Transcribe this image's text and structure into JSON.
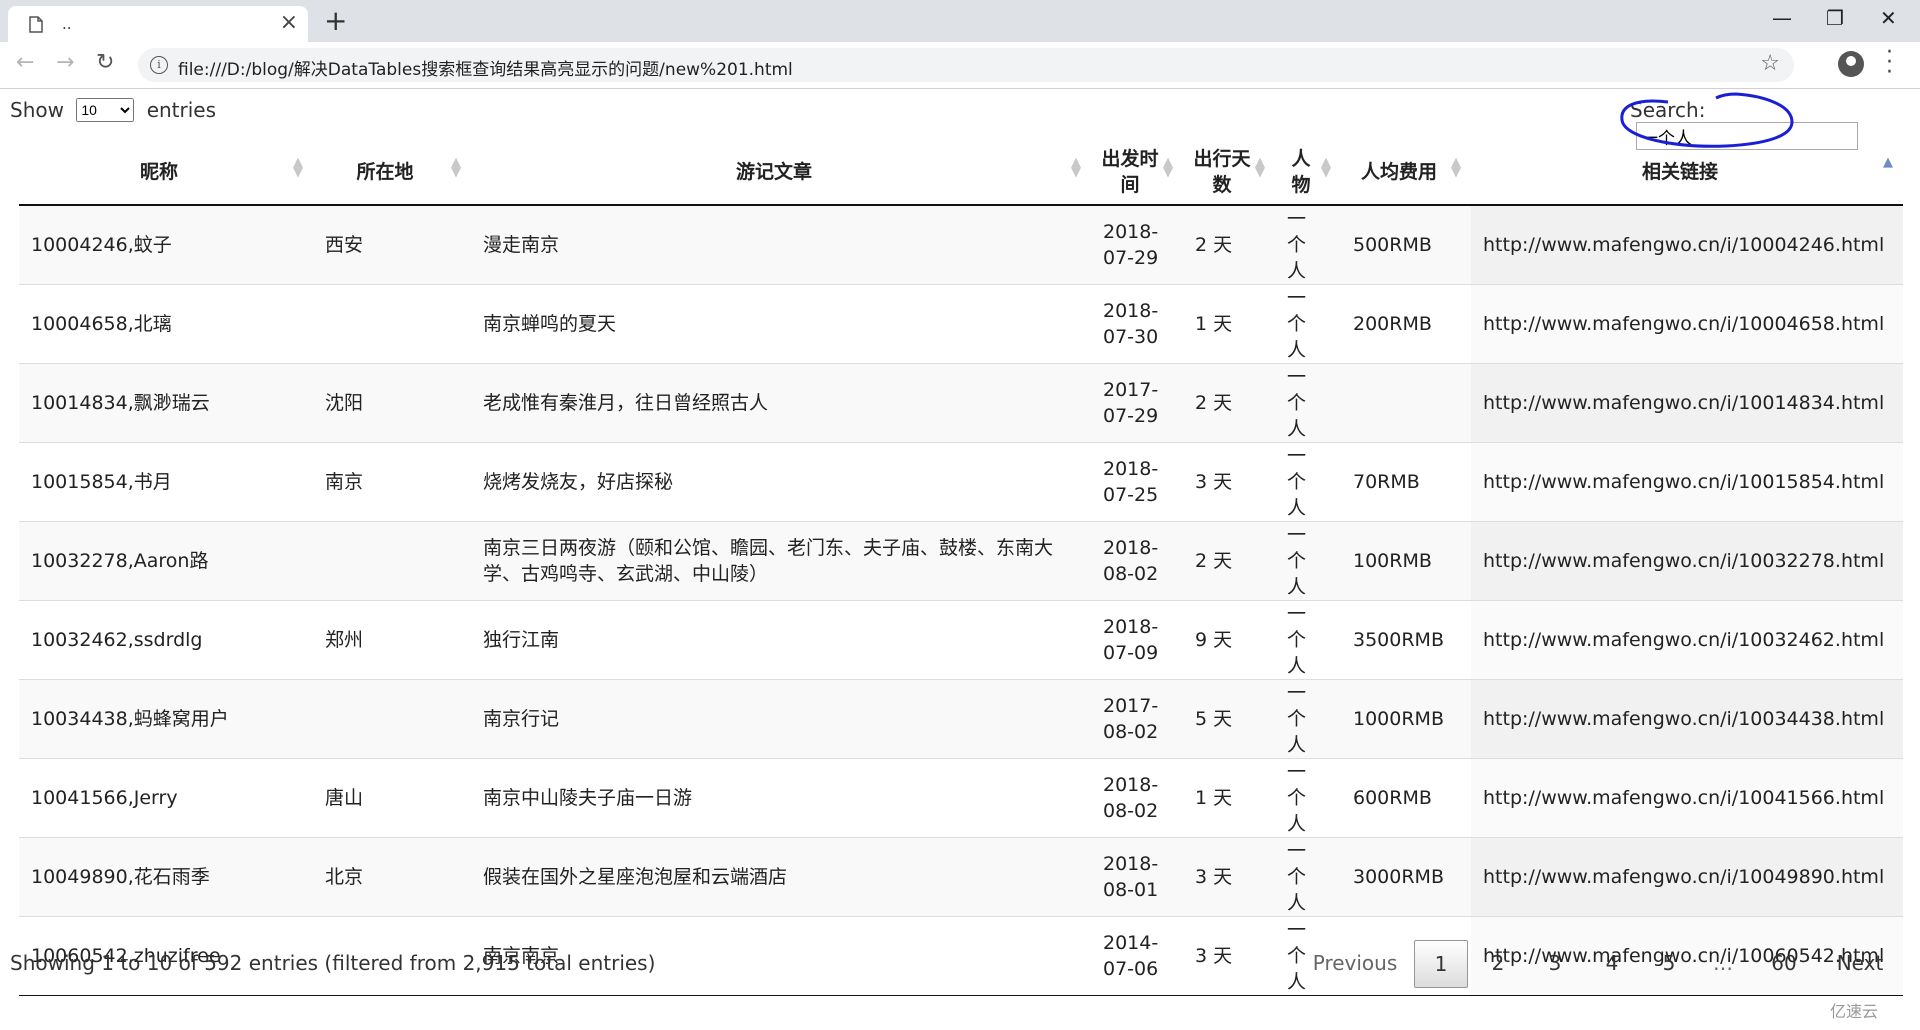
{
  "browser": {
    "tab_title": "..",
    "url": "file:///D:/blog/解决DataTables搜索框查询结果高亮显示的问题/new%201.html"
  },
  "length": {
    "show_label": "Show",
    "entries_label": "entries",
    "selected": "10"
  },
  "search": {
    "label": "Search:",
    "value": "一个人"
  },
  "table": {
    "headers": [
      "昵称",
      "所在地",
      "游记文章",
      "出发时间",
      "出行天数",
      "人物",
      "人均费用",
      "相关链接"
    ],
    "rows": [
      [
        "10004246,蚊子",
        "西安",
        "漫走南京",
        "2018-07-29",
        "2 天",
        "一个人",
        "500RMB",
        "http://www.mafengwo.cn/i/10004246.html"
      ],
      [
        "10004658,北璃",
        "",
        "南京蝉鸣的夏天",
        "2018-07-30",
        "1 天",
        "一个人",
        "200RMB",
        "http://www.mafengwo.cn/i/10004658.html"
      ],
      [
        "10014834,飘渺瑞云",
        "沈阳",
        "老成惟有秦淮月，往日曾经照古人",
        "2017-07-29",
        "2 天",
        "一个人",
        "",
        "http://www.mafengwo.cn/i/10014834.html"
      ],
      [
        "10015854,书月",
        "南京",
        "烧烤发烧友，好店探秘",
        "2018-07-25",
        "3 天",
        "一个人",
        "70RMB",
        "http://www.mafengwo.cn/i/10015854.html"
      ],
      [
        "10032278,Aaron路",
        "",
        "南京三日两夜游（颐和公馆、瞻园、老门东、夫子庙、鼓楼、东南大学、古鸡鸣寺、玄武湖、中山陵）",
        "2018-08-02",
        "2 天",
        "一个人",
        "100RMB",
        "http://www.mafengwo.cn/i/10032278.html"
      ],
      [
        "10032462,ssdrdlg",
        "郑州",
        "独行江南",
        "2018-07-09",
        "9 天",
        "一个人",
        "3500RMB",
        "http://www.mafengwo.cn/i/10032462.html"
      ],
      [
        "10034438,蚂蜂窝用户",
        "",
        "南京行记",
        "2017-08-02",
        "5 天",
        "一个人",
        "1000RMB",
        "http://www.mafengwo.cn/i/10034438.html"
      ],
      [
        "10041566,Jerry",
        "唐山",
        "南京中山陵夫子庙一日游",
        "2018-08-02",
        "1 天",
        "一个人",
        "600RMB",
        "http://www.mafengwo.cn/i/10041566.html"
      ],
      [
        "10049890,花石雨季",
        "北京",
        "假装在国外之星座泡泡屋和云端酒店",
        "2018-08-01",
        "3 天",
        "一个人",
        "3000RMB",
        "http://www.mafengwo.cn/i/10049890.html"
      ],
      [
        "10060542,zhuzifree",
        "",
        "南京南京",
        "2014-07-06",
        "3 天",
        "一个人",
        "",
        "http://www.mafengwo.cn/i/10060542.html"
      ]
    ]
  },
  "info": "Showing 1 to 10 of 592 entries (filtered from 2,915 total entries)",
  "paging": {
    "previous": "Previous",
    "pages": [
      "1",
      "2",
      "3",
      "4",
      "5",
      "…",
      "60"
    ],
    "next": "Next",
    "current": "1"
  },
  "watermark": "亿速云",
  "colors": {
    "circle": "#1a1fd6",
    "tabstrip": "#dee1e6"
  }
}
